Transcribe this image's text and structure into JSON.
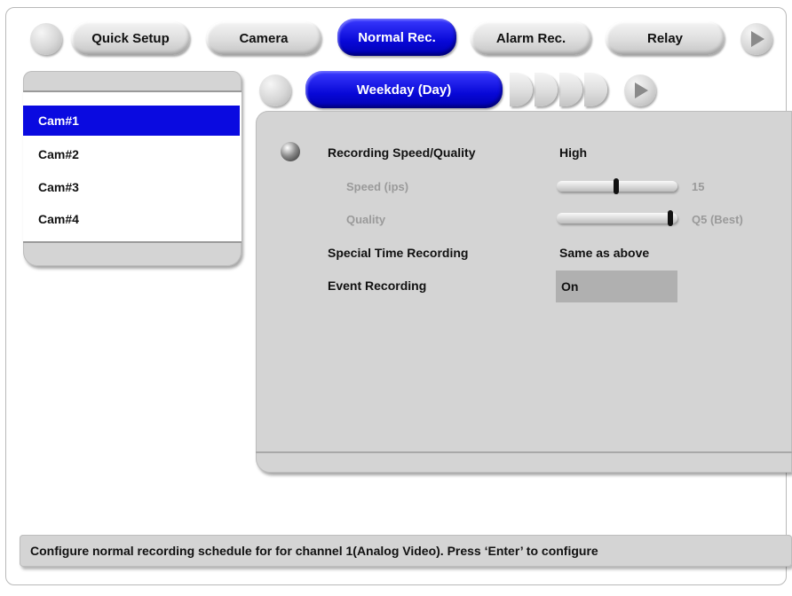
{
  "top_tabs": {
    "items": [
      {
        "label": "Quick Setup",
        "active": false
      },
      {
        "label": "Camera",
        "active": false
      },
      {
        "label": "Normal Rec.",
        "active": true
      },
      {
        "label": "Alarm Rec.",
        "active": false
      },
      {
        "label": "Relay",
        "active": false
      }
    ]
  },
  "camera_list": {
    "items": [
      {
        "label": "Cam#1",
        "selected": true
      },
      {
        "label": "Cam#2",
        "selected": false
      },
      {
        "label": "Cam#3",
        "selected": false
      },
      {
        "label": "Cam#4",
        "selected": false
      }
    ]
  },
  "sub_tabs": {
    "active_label": "Weekday (Day)"
  },
  "settings": {
    "recording_speed_quality": {
      "label": "Recording Speed/Quality",
      "value": "High"
    },
    "speed": {
      "label": "Speed (ips)",
      "value": "15",
      "level": 0.5
    },
    "quality": {
      "label": "Quality",
      "value": "Q5 (Best)",
      "level": 1.0
    },
    "special_time_recording": {
      "label": "Special Time Recording",
      "value": "Same as above"
    },
    "event_recording": {
      "label": "Event Recording",
      "value": "On"
    }
  },
  "status_bar": {
    "text": "Configure normal recording schedule for for channel 1(Analog Video). Press ‘Enter’ to configure"
  },
  "colors": {
    "accent_blue": "#0a0ae0",
    "panel_gray": "#d4d4d4",
    "disabled_text": "#9a9a9a"
  }
}
